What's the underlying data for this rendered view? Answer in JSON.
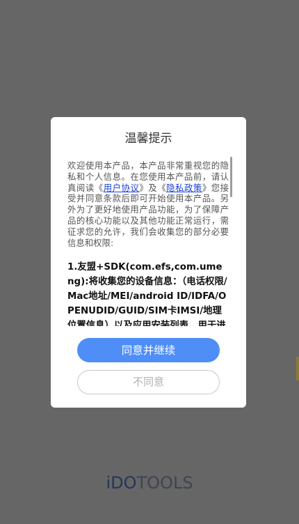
{
  "dialog": {
    "title": "温馨提示",
    "intro": {
      "part1": "欢迎使用本产品，本产品非常重视您的隐私和个人信息。在您使用本产品前，请认真阅读《",
      "user_agreement_link": "用户协议",
      "part2": "》及《",
      "privacy_policy_link": "隐私政策",
      "part3": "》您接受并同意条款后即可开始使用本产品。另外为了更好地使用产品功能，为了保障产品的核心功能以及其他功能正常运行，需征求您的允许，我们会收集您的部分必要信息和权限:"
    },
    "sdk_item": "1.友盟+SDK(com.efs,com.umeng):将收集您的设备信息：（电话权限/Mac地址/MEI/android ID/IDFA/OPENUDID/GUID/SIM卡IMSI/地理位置信息）以及应用安装列表，用于进",
    "agree_label": "同意并继续",
    "disagree_label": "不同意"
  },
  "brand": {
    "part1": "iDO",
    "part2": "TOOLS"
  },
  "colors": {
    "overlay": "#666666",
    "accent": "#4f8ef7",
    "link": "#1a3fd1"
  }
}
